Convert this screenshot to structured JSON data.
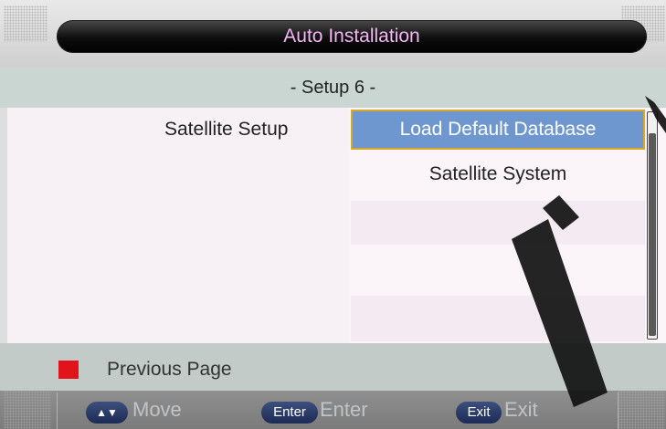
{
  "header": {
    "title": "Auto Installation"
  },
  "subtitle": "- Setup 6 -",
  "setup": {
    "label": "Satellite Setup",
    "options": [
      {
        "label": "Load Default Database",
        "selected": true
      },
      {
        "label": "Satellite System",
        "selected": false
      },
      {
        "label": "",
        "selected": false
      },
      {
        "label": "",
        "selected": false
      },
      {
        "label": "",
        "selected": false
      }
    ]
  },
  "previous_page": {
    "label": "Previous Page",
    "key_color": "#e0141a"
  },
  "footer": {
    "move_key": "▲▼",
    "move_label": "Move",
    "enter_key": "Enter",
    "enter_label": "Enter",
    "exit_key": "Exit",
    "exit_label": "Exit"
  },
  "colors": {
    "selected_bg": "#6f97cf",
    "selected_border": "#d8a824",
    "title_text": "#f3b6f3"
  }
}
